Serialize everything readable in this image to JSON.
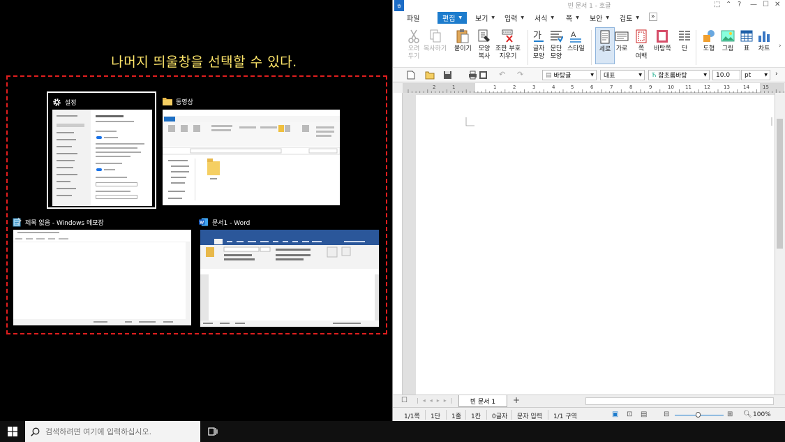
{
  "snap_assist": {
    "caption": "나머지 띄울창을 선택할 수 있다.",
    "thumbnails": [
      {
        "title": "설정",
        "icon": "gear-icon",
        "selected": true
      },
      {
        "title": "동영상",
        "icon": "folder-icon"
      },
      {
        "title": "제목 없음 - Windows 메모장",
        "icon": "notepad-icon"
      },
      {
        "title": "문서1 - Word",
        "icon": "word-icon"
      }
    ]
  },
  "hwp": {
    "title": "빈 문서 1 - 호글",
    "menu": [
      "파일",
      "편집",
      "보기",
      "입력",
      "서식",
      "쪽",
      "보안",
      "검토"
    ],
    "ribbon": {
      "cut": "오려\n두기",
      "copy": "복사하기",
      "paste": "붙이기",
      "format_copy": "모양\n복사",
      "delete_format": "조판 부호\n지우기",
      "char_shape": "글자\n모양",
      "para_shape": "문단\n모양",
      "style": "스타일",
      "portrait": "세로",
      "landscape": "가로",
      "margin": "쪽\n여백",
      "background": "바탕쪽",
      "columns": "단",
      "shapes": "도형",
      "picture": "그림",
      "table": "표",
      "chart": "차트"
    },
    "toolbar": {
      "style": "바탕글",
      "lang": "대표",
      "font": "함초롬바탕",
      "size": "10.0",
      "unit": "pt"
    },
    "ruler_numbers": [
      "2",
      "1",
      "1",
      "2",
      "3",
      "4",
      "5",
      "6",
      "7",
      "8",
      "9",
      "10",
      "11",
      "12",
      "13",
      "14",
      "15"
    ],
    "tab_name": "빈 문서 1",
    "add_tab": "+",
    "status": {
      "page": "1/1쪽",
      "section": "1단",
      "line": "1줄",
      "col": "1칸",
      "chars": "0글자",
      "mode": "문자 입력",
      "area": "1/1 구역",
      "zoom": "100%"
    }
  },
  "taskbar": {
    "search_placeholder": "검색하려면 여기에 입력하십시오."
  },
  "colors": {
    "caption": "#ffe66a",
    "dashed_border": "#e01e1e",
    "hwp_accent": "#1d7ccd"
  }
}
